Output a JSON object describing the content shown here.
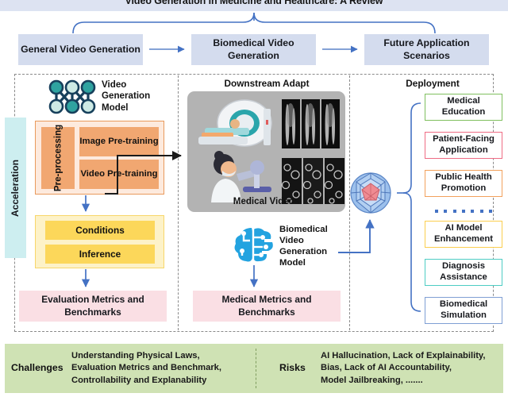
{
  "title": "Video Generation in Medicine and Healthcare: A Review",
  "pipeline_levels": [
    {
      "label": "General Video Generation"
    },
    {
      "label": "Biomedical Video Generation"
    },
    {
      "label": "Future Application Scenarios"
    }
  ],
  "left_column": {
    "acceleration_label": "Acceleration",
    "model_label": "Video Generation Model",
    "model_icon": "neural-network-icon",
    "preprocessing_label": "Pre-processing",
    "pretrain_image": "Image Pre-training",
    "pretrain_video": "Video Pre-training",
    "conditions": "Conditions",
    "inference": "Inference",
    "evaluation": "Evaluation Metrics and Benchmarks"
  },
  "middle_column": {
    "section_title": "Downstream Adapt",
    "media_caption": "Medical Videos",
    "media_icons": [
      "mri-scanner-icon",
      "xray-frames-icon",
      "microscopist-icon",
      "cell-microscopy-frames-icon"
    ],
    "model_label": "Biomedical Video Generation Model",
    "model_icon": "brain-circuit-icon",
    "metrics": "Medical Metrics and Benchmarks"
  },
  "right_column": {
    "section_title": "Deployment",
    "hub_icon": "geodesic-sphere-icon",
    "separator": "dotted-separator",
    "items": [
      {
        "label": "Medical Education",
        "border": "#7fbf5e"
      },
      {
        "label": "Patient-Facing Application",
        "border": "#ef6c84"
      },
      {
        "label": "Public Health Promotion",
        "border": "#f2a15c"
      },
      {
        "label": "AI Model Enhancement",
        "border": "#fbce4e"
      },
      {
        "label": "Diagnosis Assistance",
        "border": "#4ecdc4"
      },
      {
        "label": "Biomedical Simulation",
        "border": "#7f9fd4"
      }
    ]
  },
  "bottom_panel": {
    "challenges_title": "Challenges",
    "challenges_body": "Understanding Physical Laws,\nEvaluation Metrics and Benchmark,\nControllability and Explanability",
    "risks_title": "Risks",
    "risks_body": "AI Hallucination, Lack of Explainability,\nBias,   Lack of AI Accountability,\nModel Jailbreaking, ......."
  },
  "colors": {
    "title_bar": "#dde3f2",
    "level_box": "#d4dcee",
    "accel": "#cdeef0",
    "orange": "#f1a771",
    "yellow": "#fcd75a",
    "pink": "#fadfe4",
    "green_panel": "#cfe2b4",
    "arrow_blue": "#4472c4"
  }
}
